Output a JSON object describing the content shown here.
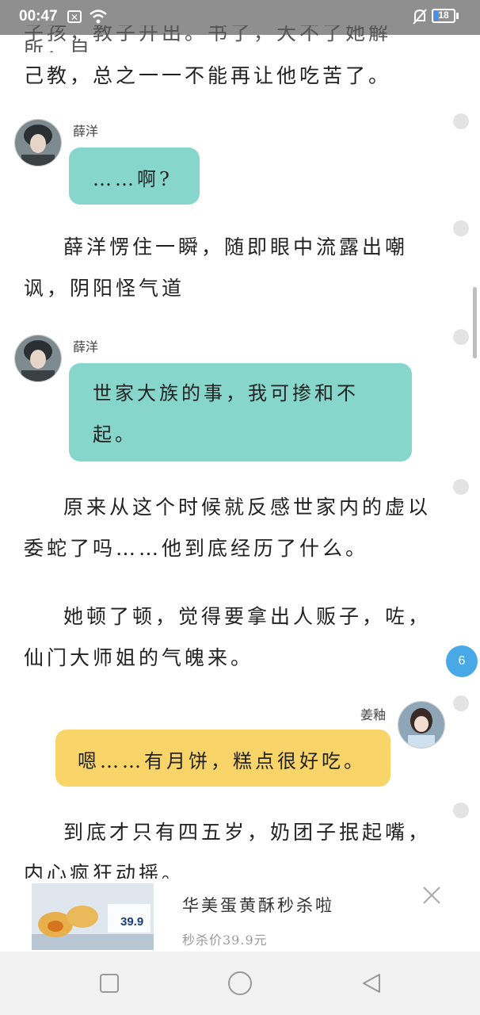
{
  "status": {
    "time": "00:47",
    "battery": "18"
  },
  "paragraphs": {
    "p0_line1": "子孩，教子开出。书了，大不了她解所，自",
    "p0_line2": "己教，总之一一不能再让他吃苦了。",
    "p1": "薛洋愣住一瞬，随即眼中流露出嘲讽，阴阳怪气道",
    "p2": "原来从这个时候就反感世家内的虚以委蛇了吗……他到底经历了什么。",
    "p3": "她顿了顿，觉得要拿出人贩子，咗，仙门大师姐的气魄来。",
    "p4": "到底才只有四五岁，奶团子抿起嘴，内心疯狂动摇。"
  },
  "messages": [
    {
      "speaker": "薛洋",
      "text": "……啊?"
    },
    {
      "speaker": "薛洋",
      "text": "世家大族的事，我可掺和不起。"
    },
    {
      "speaker": "姜釉",
      "text": "嗯……有月饼，糕点很好吃。"
    }
  ],
  "page_badge": "6",
  "ad": {
    "title": "华美蛋黄酥秒杀啦",
    "subtitle": "秒杀价39.9元",
    "image_price": "39.9"
  },
  "colors": {
    "teal_bubble": "#86d6cc",
    "yellow_bubble": "#f9d468",
    "badge": "#49a8e6"
  }
}
